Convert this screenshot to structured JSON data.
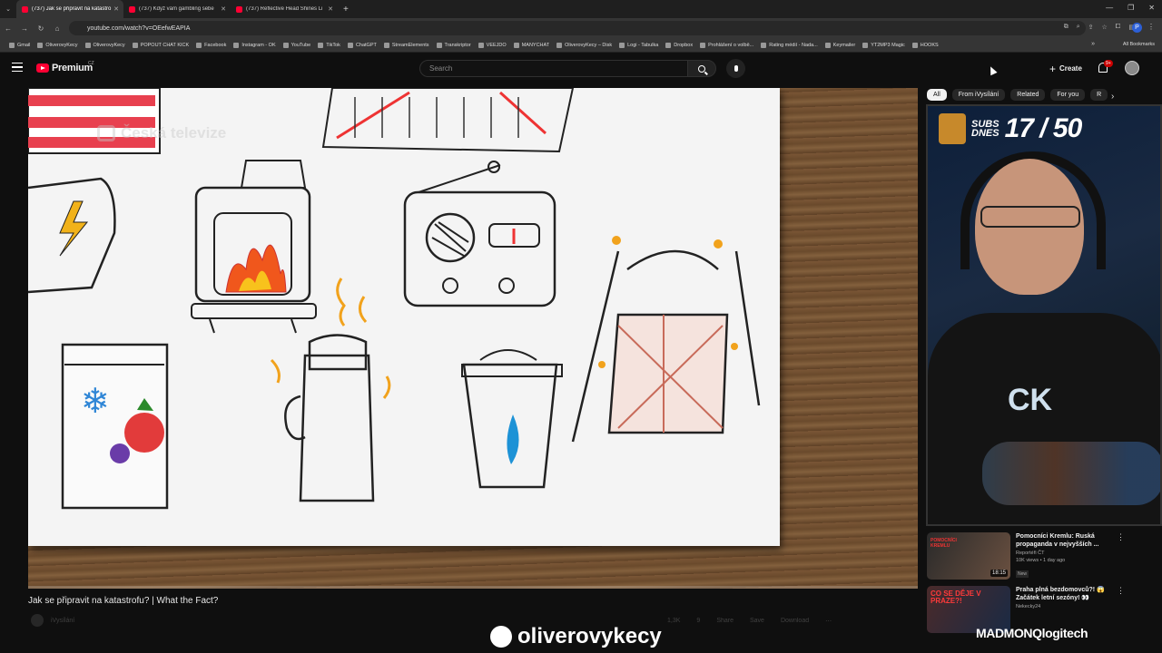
{
  "browser": {
    "tabs": [
      {
        "title": "(737) Jak se připravit na katastro",
        "active": true
      },
      {
        "title": "(737) Když vám gambling sebe",
        "active": false
      },
      {
        "title": "(737) Reflective Head Shines Li",
        "active": false
      }
    ],
    "new_tab": "+",
    "url": "youtube.com/watch?v=OEefwEAPIA",
    "profile_initial": "P",
    "bookmarks": [
      "Gmail",
      "OliverovyKecy",
      "OliverovyKecy",
      "POPOUT CHAT KICK",
      "Facebook",
      "Instagram - OK",
      "YouTube",
      "TikTok",
      "ChatGPT",
      "StreamElements",
      "Transkriptor",
      "VEEJDO",
      "MANYCHAT",
      "OliverovyKecy – Disk",
      "Logi - Tabulka",
      "Dropbox",
      "Prohlášení o volbě...",
      "Rating médií - Nada...",
      "Keymailer",
      "YT2MP3 Magic",
      "HOOKS"
    ],
    "all_bookmarks": "All Bookmarks"
  },
  "youtube": {
    "logo": "Premium",
    "logo_sup": "CZ",
    "search_placeholder": "Search",
    "create_label": "Create",
    "notifications_badge": "9+"
  },
  "video": {
    "title": "Jak se připravit na katastrofu? | What the Fact?",
    "watermark": "Česká televize",
    "channel": "iVysílání",
    "actions": [
      "1,3K",
      "9",
      "Share",
      "Save",
      "Download",
      "⋯"
    ]
  },
  "chips": [
    {
      "label": "All",
      "selected": true
    },
    {
      "label": "From iVysílání",
      "selected": false
    },
    {
      "label": "Related",
      "selected": false
    },
    {
      "label": "For you",
      "selected": false
    },
    {
      "label": "R",
      "selected": false
    }
  ],
  "webcam": {
    "subs_label_1": "SUBS",
    "subs_label_2": "DNES",
    "subs_count": "17 / 50",
    "shirt_text": "CK"
  },
  "recommendations": [
    {
      "title": "Pomocníci Kremlu: Ruská propaganda v nejvyšších ...",
      "channel": "Reportéři ČT",
      "stats": "10K views • 1 day ago",
      "badge": "New",
      "duration": "18:15",
      "thumb_caption": "POMOCNÍCI KREMLU"
    },
    {
      "title": "Praha plná bezdomovců?! 😱 Začátek letní sezóny! 👀",
      "channel": "Nekecky24",
      "stats": "",
      "badge": "",
      "duration": "",
      "thumb_caption": "CO SE DĚJE V PRAZE?!"
    }
  ],
  "overlay": {
    "channel_handle": "oliverovykecy",
    "sponsor": "MADMONQlogitech"
  }
}
